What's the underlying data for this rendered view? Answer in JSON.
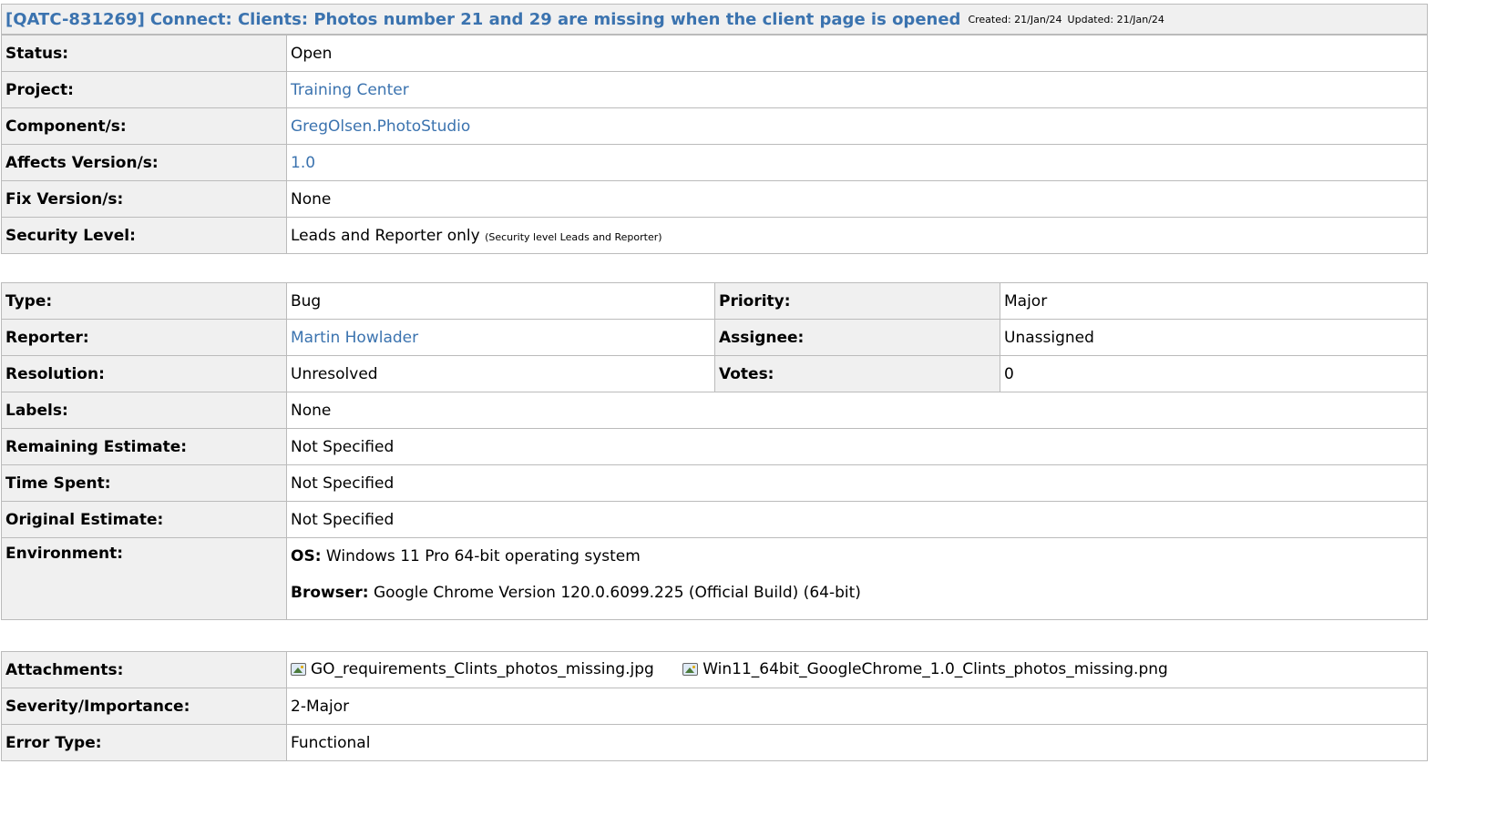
{
  "issue": {
    "key": "[QATC-831269]",
    "summary": "Connect: Clients: Photos number 21 and 29 are missing when the client page is opened",
    "created": "Created: 21/Jan/24",
    "updated": "Updated: 21/Jan/24"
  },
  "details": {
    "status_label": "Status:",
    "status": "Open",
    "project_label": "Project:",
    "project": "Training Center",
    "component_label": "Component/s:",
    "component": "GregOlsen.PhotoStudio",
    "affects_label": "Affects Version/s:",
    "affects": "1.0",
    "fix_label": "Fix Version/s:",
    "fix": "None",
    "security_label": "Security Level:",
    "security": "Leads and Reporter only",
    "security_note": "(Security level Leads and Reporter)"
  },
  "fields": {
    "type_label": "Type:",
    "type": "Bug",
    "priority_label": "Priority:",
    "priority": "Major",
    "reporter_label": "Reporter:",
    "reporter": "Martin Howlader",
    "assignee_label": "Assignee:",
    "assignee": "Unassigned",
    "resolution_label": "Resolution:",
    "resolution": "Unresolved",
    "votes_label": "Votes:",
    "votes": "0",
    "labels_label": "Labels:",
    "labels": "None",
    "remaining_label": "Remaining Estimate:",
    "remaining": "Not Specified",
    "timespent_label": "Time Spent:",
    "timespent": "Not Specified",
    "original_label": "Original Estimate:",
    "original": "Not Specified",
    "environment_label": "Environment:",
    "os_label": "OS:",
    "os": "Windows 11 Pro 64-bit operating system",
    "browser_label": "Browser:",
    "browser": "Google Chrome Version 120.0.6099.225 (Official Build) (64-bit)"
  },
  "custom": {
    "attachments_label": "Attachments:",
    "attachments": [
      "GO_requirements_Clints_photos_missing.jpg",
      "Win11_64bit_GoogleChrome_1.0_Clints_photos_missing.png"
    ],
    "attachment_icon": "image-file-icon",
    "severity_label": "Severity/Importance:",
    "severity": "2-Major",
    "errortype_label": "Error Type:",
    "errortype": "Functional"
  },
  "colors": {
    "link": "#3b73af",
    "label_bg": "#f0f0f0",
    "border": "#bbbbbb"
  }
}
